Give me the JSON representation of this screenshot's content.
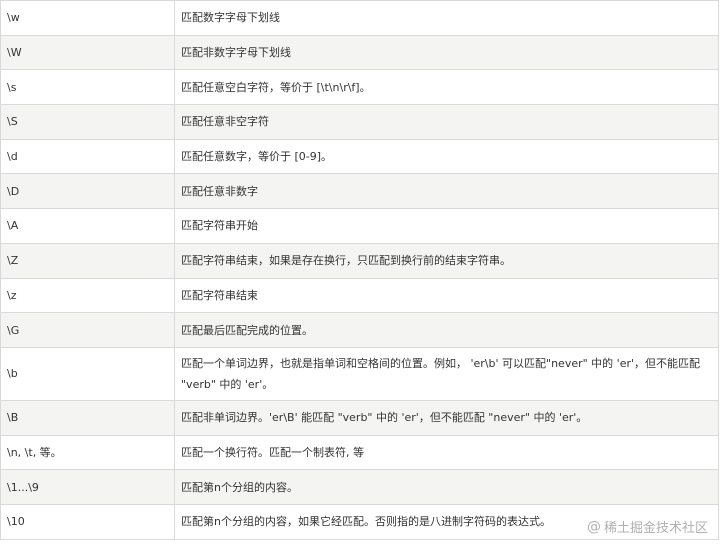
{
  "table": {
    "rows": [
      {
        "pattern": "\\w",
        "description": "匹配数字字母下划线"
      },
      {
        "pattern": "\\W",
        "description": "匹配非数字字母下划线"
      },
      {
        "pattern": "\\s",
        "description": "匹配任意空白字符，等价于 [\\t\\n\\r\\f]。"
      },
      {
        "pattern": "\\S",
        "description": "匹配任意非空字符"
      },
      {
        "pattern": "\\d",
        "description": "匹配任意数字，等价于 [0-9]。"
      },
      {
        "pattern": "\\D",
        "description": "匹配任意非数字"
      },
      {
        "pattern": "\\A",
        "description": "匹配字符串开始"
      },
      {
        "pattern": "\\Z",
        "description": "匹配字符串结束，如果是存在换行，只匹配到换行前的结束字符串。"
      },
      {
        "pattern": "\\z",
        "description": "匹配字符串结束"
      },
      {
        "pattern": "\\G",
        "description": "匹配最后匹配完成的位置。"
      },
      {
        "pattern": "\\b",
        "description": "匹配一个单词边界，也就是指单词和空格间的位置。例如， 'er\\b' 可以匹配\"never\" 中的 'er'，但不能匹配 \"verb\" 中的 'er'。"
      },
      {
        "pattern": "\\B",
        "description": "匹配非单词边界。'er\\B' 能匹配 \"verb\" 中的 'er'，但不能匹配 \"never\" 中的 'er'。"
      },
      {
        "pattern": "\\n, \\t, 等。",
        "description": "匹配一个换行符。匹配一个制表符, 等"
      },
      {
        "pattern": "\\1...\\9",
        "description": "匹配第n个分组的内容。"
      },
      {
        "pattern": "\\10",
        "description": "匹配第n个分组的内容，如果它经匹配。否则指的是八进制字符码的表达式。"
      }
    ]
  },
  "watermark": {
    "symbol": "@",
    "text": "稀土掘金技术社区"
  }
}
